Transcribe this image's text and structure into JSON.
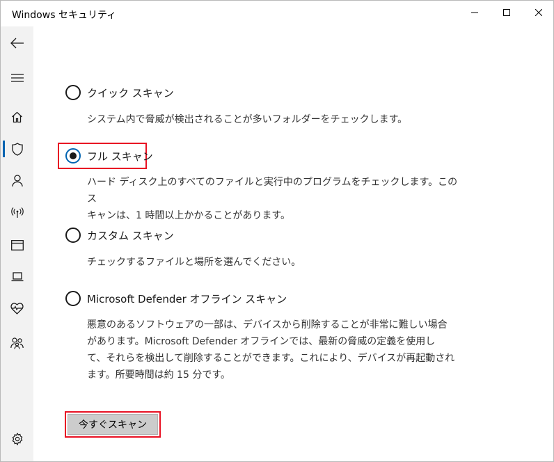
{
  "window": {
    "title": "Windows セキュリティ",
    "controls": [
      "minimize-icon",
      "maximize-icon",
      "close-icon"
    ]
  },
  "sidebar": {
    "items": [
      {
        "icon": "back-arrow-icon",
        "active": false
      },
      {
        "icon": "hamburger-menu-icon",
        "active": false
      },
      {
        "icon": "home-icon",
        "active": false
      },
      {
        "icon": "shield-icon",
        "active": true
      },
      {
        "icon": "person-icon",
        "active": false
      },
      {
        "icon": "wifi-antenna-icon",
        "active": false
      },
      {
        "icon": "app-browser-icon",
        "active": false
      },
      {
        "icon": "laptop-icon",
        "active": false
      },
      {
        "icon": "heart-pulse-icon",
        "active": false
      },
      {
        "icon": "family-icon",
        "active": false
      },
      {
        "icon": "settings-gear-icon",
        "active": false
      }
    ],
    "accent": "#0063b1"
  },
  "main": {
    "scan_options": [
      {
        "label": "クイック スキャン",
        "selected": false,
        "description_lines": [
          "システム内で脅威が検出されることが多いフォルダーをチェックします。"
        ]
      },
      {
        "label": "フル スキャン",
        "selected": true,
        "description_lines": [
          "ハード ディスク上のすべてのファイルと実行中のプログラムをチェックします。このス",
          "キャンは、1 時間以上かかることがあります。"
        ]
      },
      {
        "label": "カスタム スキャン",
        "selected": false,
        "description_lines": [
          "チェックするファイルと場所を選んでください。"
        ]
      },
      {
        "label": "Microsoft Defender オフライン スキャン",
        "selected": false,
        "description_lines": [
          "悪意のあるソフトウェアの一部は、デバイスから削除することが非常に難しい場合",
          "があります。Microsoft Defender オフラインでは、最新の脅威の定義を使用し",
          "て、それらを検出して削除することができます。これにより、デバイスが再起動され",
          "ます。所要時間は約 15 分です。"
        ]
      }
    ],
    "scan_button_label": "今すぐスキャン",
    "highlight_color": "#e81123"
  }
}
